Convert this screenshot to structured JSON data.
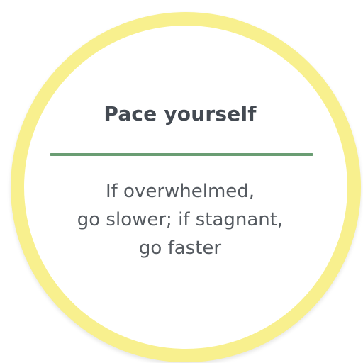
{
  "card": {
    "title": "Pace yourself",
    "lines": [
      "If overwhelmed,",
      "go slower; if stagnant,",
      "go faster"
    ]
  },
  "colors": {
    "ring": "#f8f08e",
    "divider": "#6a9d73",
    "title_text": "#444a52",
    "body_text": "#555a60",
    "background": "#ffffff"
  }
}
